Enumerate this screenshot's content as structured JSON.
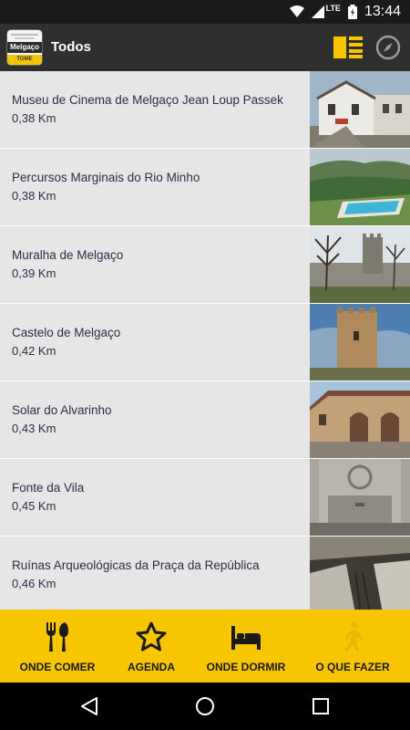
{
  "status_bar": {
    "network": "LTE",
    "time": "13:44"
  },
  "app_bar": {
    "logo_text": "Melgaço",
    "logo_sub": "TOME",
    "title": "Todos",
    "list_view_icon": "list-view-icon",
    "compass_icon": "compass-icon"
  },
  "places": [
    {
      "name": "Museu de Cinema de Melgaço Jean Loup Passek",
      "distance": "0,38 Km",
      "image": "museum-building-photo"
    },
    {
      "name": "Percursos Marginais do Rio Minho",
      "distance": "0,38 Km",
      "image": "river-pool-photo"
    },
    {
      "name": "Muralha de Melgaço",
      "distance": "0,39 Km",
      "image": "castle-wall-photo"
    },
    {
      "name": "Castelo de Melgaço",
      "distance": "0,42 Km",
      "image": "castle-tower-photo"
    },
    {
      "name": "Solar do Alvarinho",
      "distance": "0,43 Km",
      "image": "manor-house-photo"
    },
    {
      "name": "Fonte da Vila",
      "distance": "0,45 Km",
      "image": "stone-fountain-photo"
    },
    {
      "name": "Ruínas Arqueológicas da Praça da República",
      "distance": "0,46 Km",
      "image": "ruins-interior-photo"
    }
  ],
  "tabs": [
    {
      "label": "ONDE COMER",
      "icon": "fork-spoon-icon"
    },
    {
      "label": "AGENDA",
      "icon": "star-icon"
    },
    {
      "label": "ONDE DORMIR",
      "icon": "bed-icon"
    },
    {
      "label": "O QUE FAZER",
      "icon": "walking-person-icon",
      "active": true
    }
  ],
  "colors": {
    "accent": "#F7C600",
    "app_bar": "#2F2F2F",
    "row_bg": "#E6E6E6",
    "text": "#2B2F45",
    "active_icon": "#E8B800"
  }
}
